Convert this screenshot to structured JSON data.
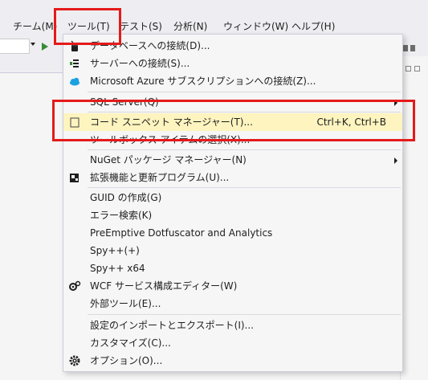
{
  "menubar": {
    "items": [
      "チーム(M)",
      "ツール(T)",
      "テスト(S)",
      "分析(N)",
      "ウィンドウ(W)",
      "ヘルプ(H)"
    ]
  },
  "tools_menu": {
    "items": [
      {
        "label": "データベースへの接続(D)...",
        "icon": "database-connect-icon"
      },
      {
        "label": "サーバーへの接続(S)...",
        "icon": "server-connect-icon"
      },
      {
        "label": "Microsoft Azure サブスクリプションへの接続(Z)...",
        "icon": "azure-cloud-icon"
      },
      {
        "label": "SQL Server(Q)",
        "submenu": true
      },
      {
        "label": "コード スニペット マネージャー(T)...",
        "shortcut": "Ctrl+K, Ctrl+B",
        "icon": "snippet-icon",
        "highlighted": true
      },
      {
        "label": "ツールボックス アイテムの選択(X)..."
      },
      {
        "label": "NuGet パッケージ マネージャー(N)",
        "submenu": true
      },
      {
        "label": "拡張機能と更新プログラム(U)...",
        "icon": "extensions-icon"
      },
      {
        "label": "GUID の作成(G)"
      },
      {
        "label": "エラー検索(K)"
      },
      {
        "label": "PreEmptive Dotfuscator and Analytics"
      },
      {
        "label": "Spy++(+)"
      },
      {
        "label": "Spy++ x64"
      },
      {
        "label": "WCF サービス構成エディター(W)",
        "icon": "wcf-config-icon"
      },
      {
        "label": "外部ツール(E)..."
      },
      {
        "label": "設定のインポートとエクスポート(I)..."
      },
      {
        "label": "カスタマイズ(C)..."
      },
      {
        "label": "オプション(O)...",
        "icon": "gear-icon"
      }
    ]
  },
  "colors": {
    "highlight": "#fdf4bf",
    "annotation_red": "#e51a1a",
    "play_green": "#388a34"
  }
}
